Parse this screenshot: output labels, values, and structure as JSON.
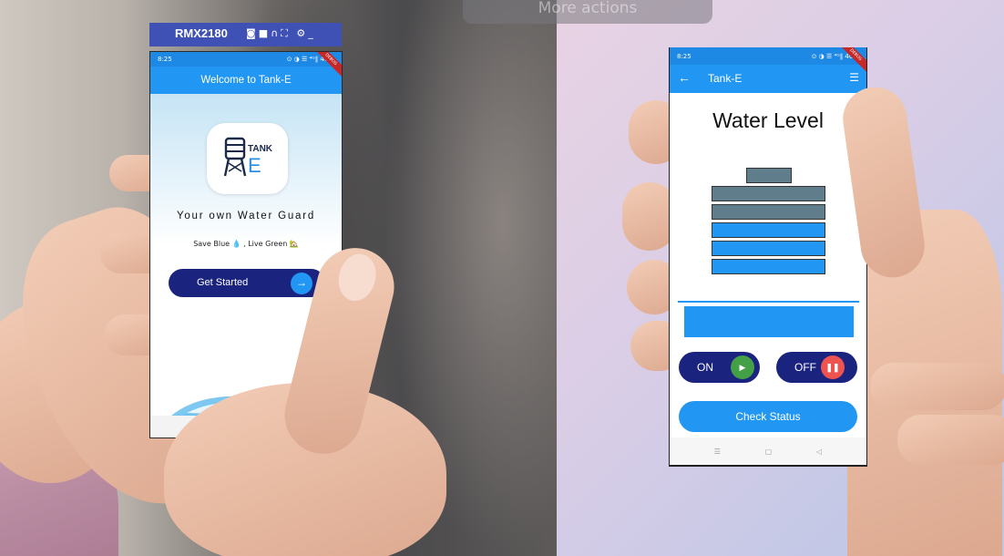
{
  "top_overlay": {
    "label": "More actions"
  },
  "emulator": {
    "device_name": "RMX2180",
    "toolbar_icons": [
      "camera-icon",
      "video-icon",
      "headphones-icon",
      "fullscreen-icon",
      "settings-icon",
      "minimize-icon"
    ]
  },
  "welcome_screen": {
    "status_time": "8:25",
    "status_icons": "⊙ ◑ ☰ ⁴ᴳ∥ 40%",
    "debug_banner": "DEBUG",
    "appbar_title": "Welcome to Tank-E",
    "logo_text": "TANK E",
    "tagline": "Your own Water Guard",
    "subtagline": "Save Blue 💧 , Live Green 🏡",
    "cta_label": "Get Started",
    "cta_icon": "arrow-right-icon",
    "nav_icons": {
      "menu": "☰",
      "home": "▢",
      "back": "◁"
    }
  },
  "level_screen": {
    "status_time": "8:25",
    "status_icons": "⊙ ◑ ☰ ⁴ᴳ∥ 40%",
    "debug_banner": "DEBUG",
    "appbar_title": "Tank-E",
    "heading": "Water Level",
    "tank_levels": [
      "empty",
      "empty",
      "full",
      "full",
      "full"
    ],
    "on_label": "ON",
    "off_label": "OFF",
    "check_label": "Check Status",
    "nav_icons": {
      "menu": "☰",
      "home": "▢",
      "back": "◁"
    },
    "colors": {
      "primary": "#2196f3",
      "dark": "#1a237e",
      "tank_empty": "#607d8b",
      "on_green": "#43a047",
      "off_red": "#ef5350"
    }
  }
}
